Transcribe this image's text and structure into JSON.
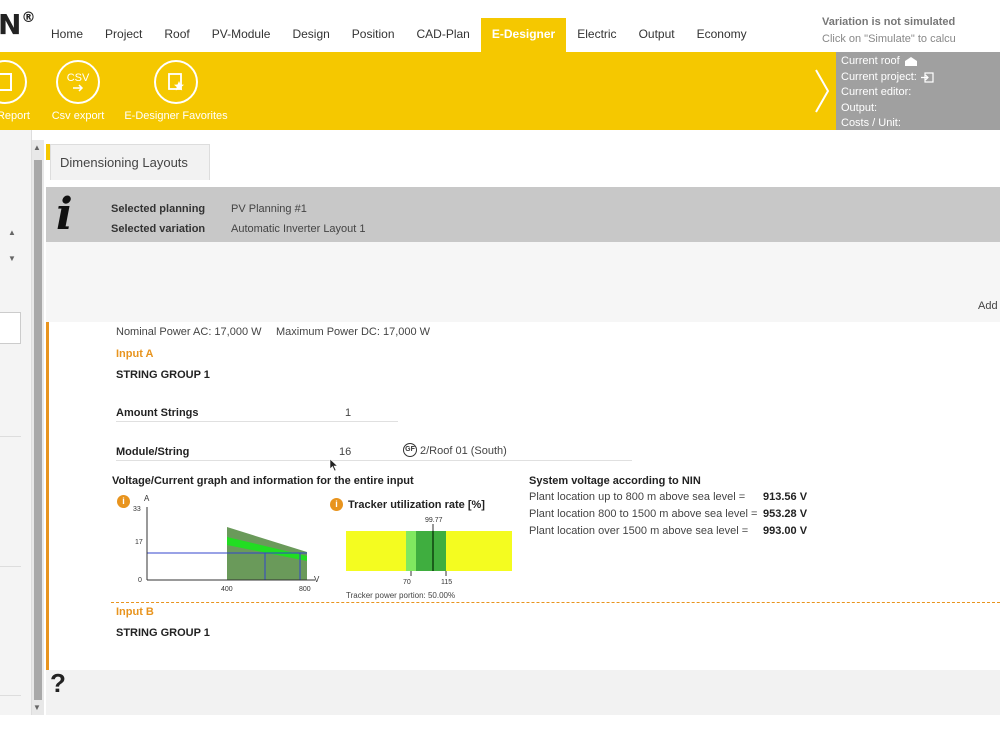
{
  "logo": "N",
  "logo_mark": "®",
  "menu": [
    "Home",
    "Project",
    "Roof",
    "PV-Module",
    "Design",
    "Position",
    "CAD-Plan",
    "E-Designer",
    "Electric",
    "Output",
    "Economy"
  ],
  "menu_active": "E-Designer",
  "ribbon": {
    "report_label": "Report",
    "csv_label": "Csv export",
    "csv_icon_text": "CSV",
    "favorites_label": "E-Designer Favorites"
  },
  "info_panel": {
    "current_roof": "Current roof",
    "current_project": "Current project:",
    "current_editor": "Current editor:",
    "output": "Output:",
    "costs_unit": "Costs / Unit:"
  },
  "tab": "Dimensioning Layouts",
  "planning": {
    "selected_planning_label": "Selected planning",
    "selected_planning_value": "PV Planning #1",
    "selected_variation_label": "Selected variation",
    "selected_variation_value": "Automatic Inverter Layout 1",
    "status": "Variation is not simulated",
    "hint": "Click on \"Simulate\" to calcu"
  },
  "add_label": "Add",
  "inverter": {
    "nominal_power": "Nominal Power AC: 17,000 W",
    "max_power": "Maximum Power DC: 17,000 W"
  },
  "input_a": {
    "title": "Input A",
    "string_group": "STRING GROUP 1",
    "amount_strings_label": "Amount Strings",
    "amount_strings_value": "1",
    "module_string_label": "Module/String",
    "module_string_value": "16",
    "roof_badge": "GF",
    "roof_label": "2/Roof 01 (South)"
  },
  "graph_title": "Voltage/Current graph and information for the entire input",
  "iv_chart": {
    "y_unit": "A",
    "x_unit": "V",
    "y_ticks": [
      "33",
      "17",
      "0"
    ],
    "x_ticks": [
      "400",
      "800"
    ]
  },
  "tracker": {
    "title": "Tracker utilization rate [%]",
    "value": "99.77",
    "tick_low": "70",
    "tick_high": "115",
    "power_portion": "Tracker power portion: 50.00%"
  },
  "system_voltage": {
    "title": "System voltage according to NIN",
    "rows": [
      {
        "label": "Plant location up to 800 m above sea level =",
        "value": "913.56 V"
      },
      {
        "label": "Plant location 800 to 1500 m above sea level =",
        "value": "953.28 V"
      },
      {
        "label": "Plant location over 1500 m above sea level =",
        "value": "993.00 V"
      }
    ]
  },
  "input_b": {
    "title": "Input B",
    "string_group": "STRING GROUP 1"
  },
  "help": "?",
  "colors": {
    "accent": "#f5c800",
    "orange": "#e8941e",
    "panel_gray": "#a0a0a0"
  }
}
